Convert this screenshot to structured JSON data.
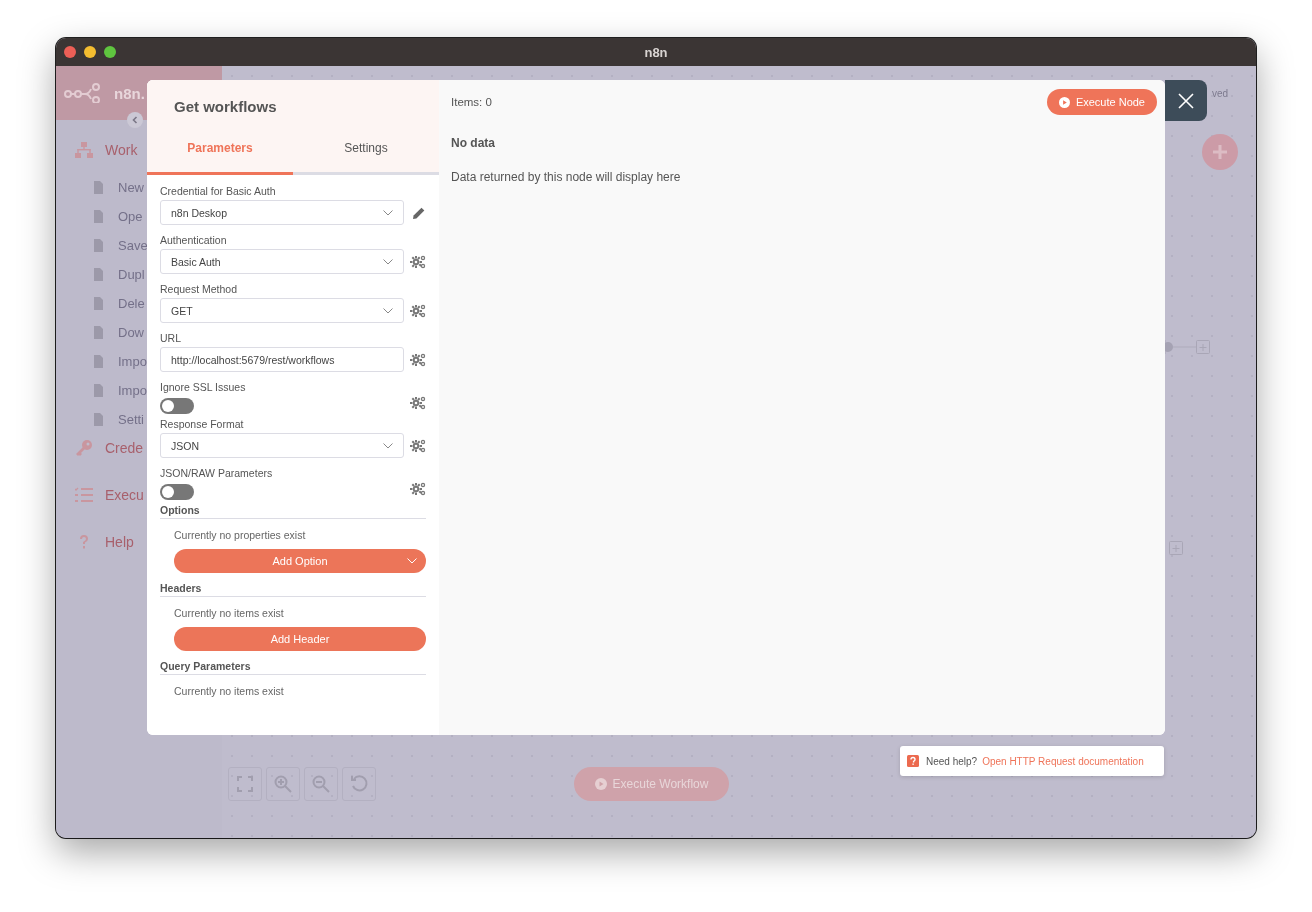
{
  "window": {
    "title": "n8n"
  },
  "sidebar": {
    "logo_text": "n8n.",
    "items": [
      {
        "label": "Work",
        "children": [
          {
            "label": "New"
          },
          {
            "label": "Ope"
          },
          {
            "label": "Save"
          },
          {
            "label": "Dupl"
          },
          {
            "label": "Dele"
          },
          {
            "label": "Dow"
          },
          {
            "label": "Impo"
          },
          {
            "label": "Impo"
          },
          {
            "label": "Setti"
          }
        ]
      },
      {
        "label": "Crede"
      },
      {
        "label": "Execu"
      },
      {
        "label": "Help"
      }
    ]
  },
  "canvas": {
    "save_status": "ved",
    "execute_button": "Execute Workflow"
  },
  "node_panel": {
    "title": "Get workflows",
    "tabs": [
      {
        "label": "Parameters",
        "selected": true
      },
      {
        "label": "Settings",
        "selected": false
      }
    ],
    "parameters": [
      {
        "kind": "select",
        "label": "Credential for Basic Auth",
        "value": "n8n Deskop"
      },
      {
        "kind": "select",
        "label": "Authentication",
        "value": "Basic Auth"
      },
      {
        "kind": "select",
        "label": "Request Method",
        "value": "GET"
      },
      {
        "kind": "input",
        "label": "URL",
        "value": "http://localhost:5679/rest/workflows"
      },
      {
        "kind": "toggle",
        "label": "Ignore SSL Issues",
        "on": false
      },
      {
        "kind": "select",
        "label": "Response Format",
        "value": "JSON"
      },
      {
        "kind": "toggle",
        "label": "JSON/RAW Parameters",
        "on": false
      }
    ],
    "sections": [
      {
        "title": "Options",
        "empty_text": "Currently no properties exist",
        "button": "Add Option",
        "dropdown": true
      },
      {
        "title": "Headers",
        "empty_text": "Currently no items exist",
        "button": "Add Header",
        "dropdown": false
      },
      {
        "title": "Query Parameters",
        "empty_text": "Currently no items exist"
      }
    ]
  },
  "output_panel": {
    "items_label": "Items: 0",
    "execute_button": "Execute Node",
    "empty_title": "No data",
    "empty_text": "Data returned by this node will display here"
  },
  "help": {
    "text": "Need help?",
    "link": "Open HTTP Request documentation"
  }
}
